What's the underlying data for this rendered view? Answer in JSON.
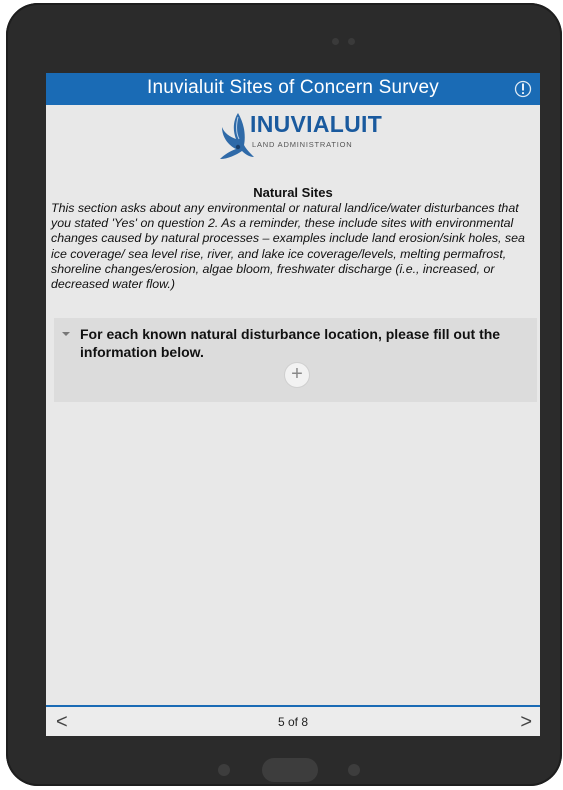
{
  "app": {
    "title": "Inuvialuit Sites of Concern Survey"
  },
  "logo": {
    "brand": "INUVIALUIT",
    "subtitle": "LAND ADMINISTRATION"
  },
  "section": {
    "title": "Natural Sites",
    "description": "This section asks about any environmental or natural land/ice/water disturbances that you stated 'Yes' on question 2. As a reminder, these include sites with environmental changes caused by natural processes – examples include land erosion/sink holes, sea ice coverage/ sea level rise, river, and lake ice coverage/levels, melting permafrost, shoreline changes/erosion, algae bloom, freshwater discharge (i.e., increased, or decreased water flow.)"
  },
  "repeat": {
    "label": "For each known natural disturbance location, please fill out the information below.",
    "add_symbol": "+"
  },
  "footer": {
    "prev_symbol": "<",
    "page_indicator": "5 of 8",
    "next_symbol": ">"
  },
  "colors": {
    "header_blue": "#1a6bb5",
    "brand_blue": "#1a5a9e",
    "background": "#e8e8e8"
  },
  "icons": {
    "alert": "alert-icon",
    "logo": "bird-logo-icon",
    "expand": "caret-down-icon",
    "add": "plus-icon"
  }
}
